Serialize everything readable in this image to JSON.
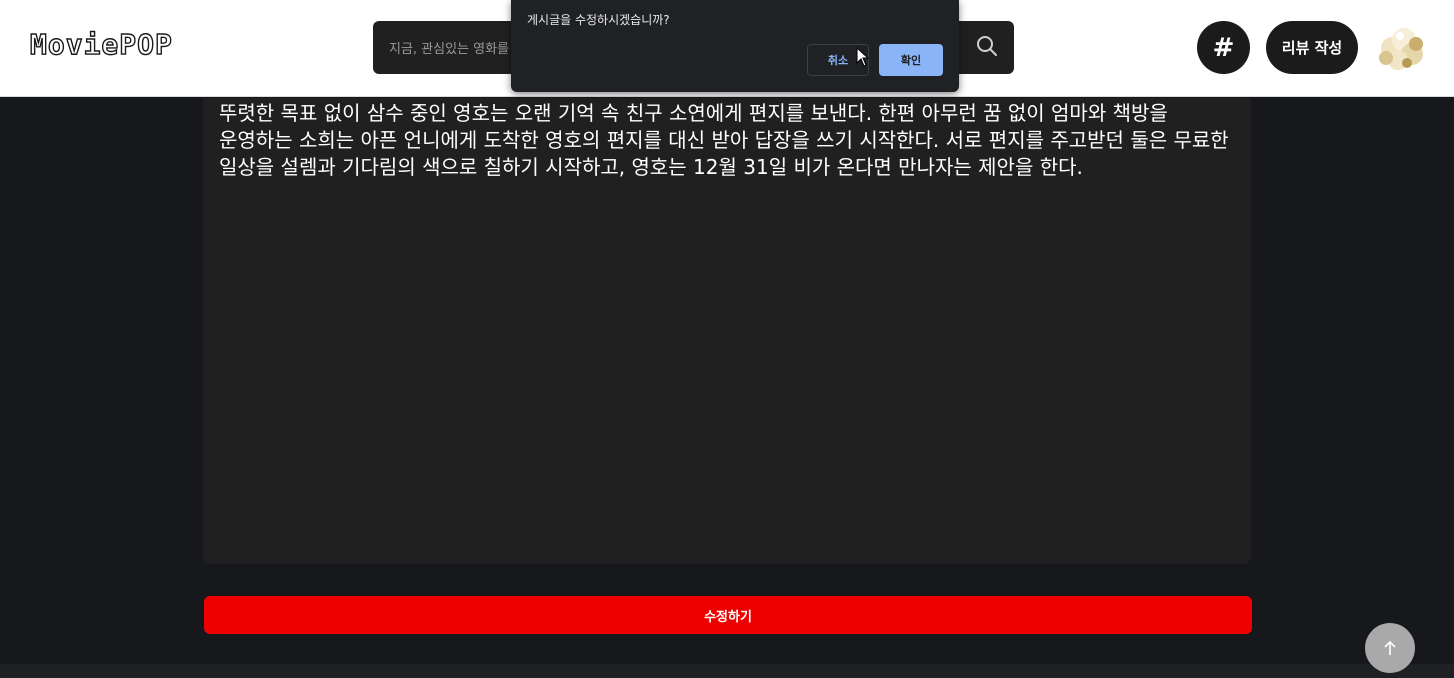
{
  "header": {
    "logo": "MoviePOP",
    "search": {
      "placeholder": "지금, 관심있는 영화를 검색해보세요!",
      "icon": "search-icon"
    },
    "hash_button": {
      "label": "#"
    },
    "review_button": {
      "label": "리뷰 작성"
    },
    "avatar": {
      "icon": "popcorn-avatar"
    }
  },
  "main": {
    "content_text": "뚜렷한 목표 없이 삼수 중인 영호는 오랜 기억 속 친구 소연에게 편지를 보낸다. 한편 아무런 꿈 없이 엄마와 책방을 운영하는 소희는 아픈 언니에게 도착한 영호의 편지를 대신 받아 답장을 쓰기 시작한다. 서로 편지를 주고받던 둘은 무료한 일상을 설렘과 기다림의 색으로 칠하기 시작하고, 영호는 12월 31일 비가 온다면 만나자는 제안을 한다.",
    "submit_button": {
      "label": "수정하기",
      "color": "#ee0000"
    }
  },
  "scroll_top": {
    "icon": "arrow-up-icon"
  },
  "dialog": {
    "message": "게시글을 수정하시겠습니까?",
    "cancel_label": "취소",
    "ok_label": "확인",
    "accent": "#8ab4f8"
  }
}
